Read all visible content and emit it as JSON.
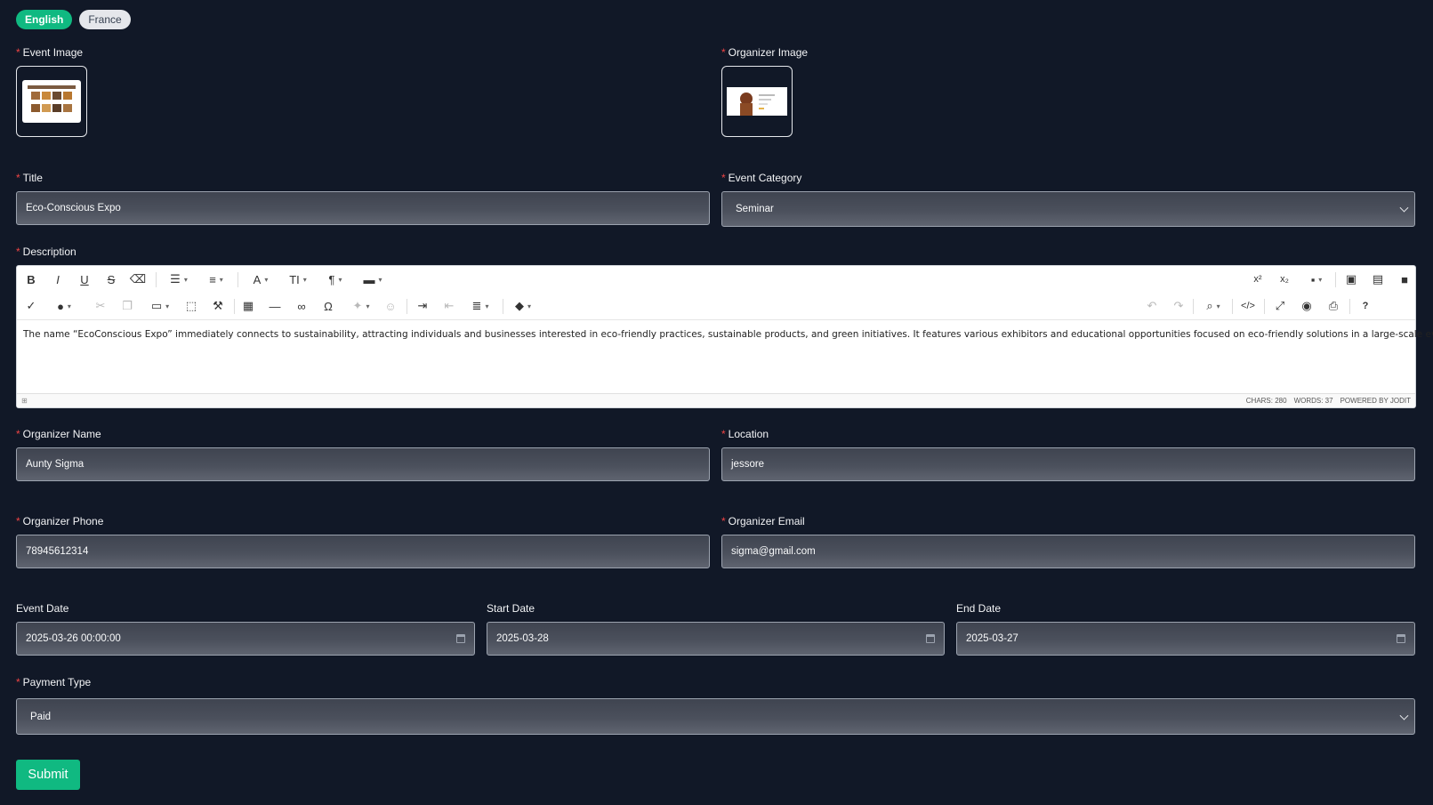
{
  "languages": {
    "english": "English",
    "france": "France"
  },
  "labels": {
    "event_image": "Event Image",
    "organizer_image": "Organizer Image",
    "title": "Title",
    "event_category": "Event Category",
    "description": "Description",
    "organizer_name": "Organizer Name",
    "location": "Location",
    "organizer_phone": "Organizer Phone",
    "organizer_email": "Organizer Email",
    "event_date": "Event Date",
    "start_date": "Start Date",
    "end_date": "End Date",
    "payment_type": "Payment Type"
  },
  "required_mark": "*",
  "values": {
    "title": "Eco-Conscious Expo",
    "event_category": "Seminar",
    "organizer_name": "Aunty Sigma",
    "location": "jessore",
    "organizer_phone": "78945612314",
    "organizer_email": "sigma@gmail.com",
    "event_date": "2025-03-26 00:00:00",
    "start_date": "2025-03-28",
    "end_date": "2025-03-27",
    "payment_type": "Paid"
  },
  "editor": {
    "content": "The name “EcoConscious Expo” immediately connects to sustainability, attracting individuals and businesses interested in eco-friendly practices, sustainable products, and green initiatives. It features various exhibitors and educational opportunities focused on eco-friendly solutions in a large-scale event setting.",
    "chars": "CHARS: 280",
    "words": "WORDS: 37",
    "powered": "POWERED BY JODIT",
    "toolbar": {
      "bold": "B",
      "italic": "I",
      "underline": "U",
      "strike": "S",
      "font": "A",
      "size": "TI",
      "paragraph": "¶",
      "superscript": "x²",
      "subscript": "x₂",
      "special_char": "Ω",
      "help": "?"
    }
  },
  "submit_label": "Submit",
  "colors": {
    "accent": "#10b981",
    "background": "#111827",
    "required": "#ef4444"
  }
}
